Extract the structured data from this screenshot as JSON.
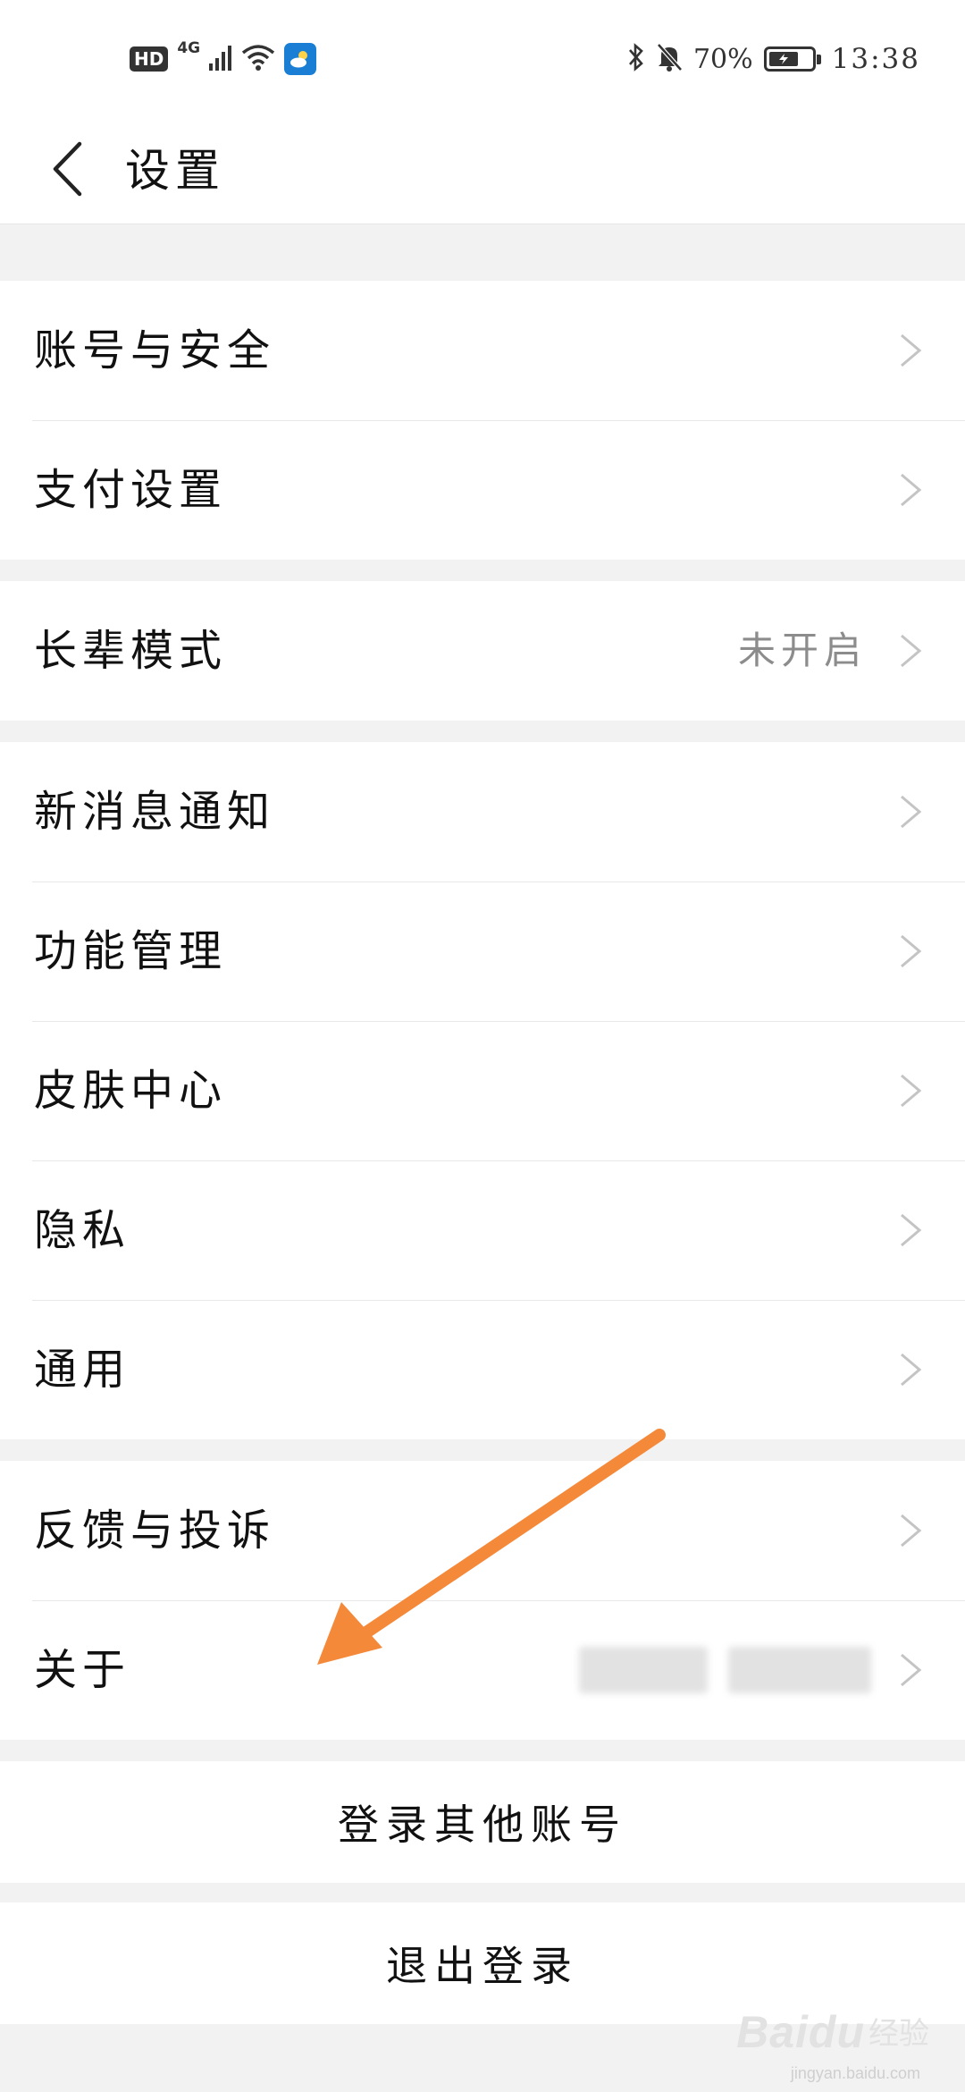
{
  "status_bar": {
    "hd_label": "HD",
    "network_label": "4G",
    "battery_text": "70%",
    "battery_level": 0.7,
    "time": "13:38"
  },
  "header": {
    "title": "设置"
  },
  "groups": {
    "account": [
      {
        "label": "账号与安全"
      },
      {
        "label": "支付设置"
      }
    ],
    "elder": [
      {
        "label": "长辈模式",
        "value": "未开启"
      }
    ],
    "general": [
      {
        "label": "新消息通知"
      },
      {
        "label": "功能管理"
      },
      {
        "label": "皮肤中心"
      },
      {
        "label": "隐私"
      },
      {
        "label": "通用"
      }
    ],
    "support": [
      {
        "label": "反馈与投诉"
      },
      {
        "label": "关于"
      }
    ]
  },
  "buttons": {
    "switch_account": "登录其他账号",
    "logout": "退出登录"
  },
  "annotation": {
    "arrow_color": "#f5893a"
  },
  "watermark": {
    "logo": "Baidu",
    "cn": "经验",
    "sub": "jingyan.baidu.com"
  }
}
